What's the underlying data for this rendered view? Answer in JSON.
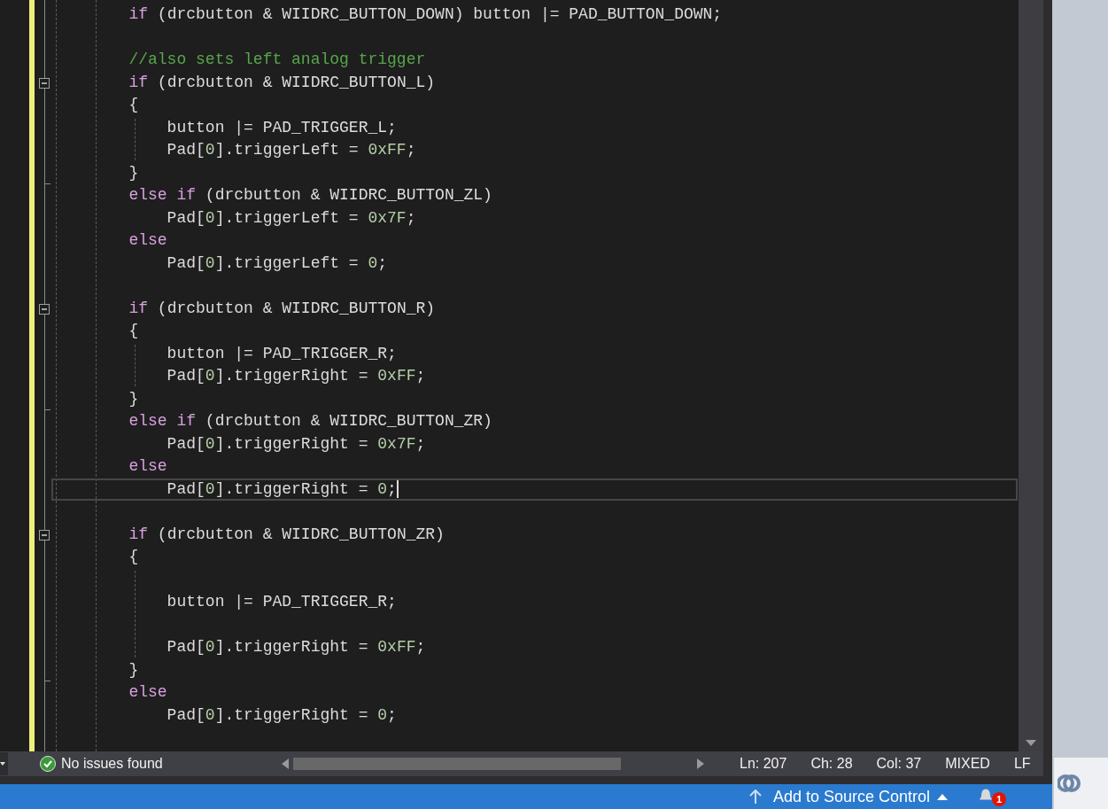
{
  "editor": {
    "lines": [
      {
        "current": false,
        "tokens": [
          {
            "kind": "keyword",
            "text": "        if"
          },
          {
            "kind": "plain",
            "text": " (drcbutton & WIIDRC_BUTTON_DOWN) button |= PAD_BUTTON_DOWN;"
          }
        ]
      },
      {
        "current": false
      },
      {
        "current": false,
        "tokens": [
          {
            "kind": "comment",
            "text": "        //also sets left analog trigger"
          }
        ]
      },
      {
        "current": false,
        "fold_start": true,
        "tokens": [
          {
            "kind": "keyword",
            "text": "        if"
          },
          {
            "kind": "plain",
            "text": " (drcbutton & WIIDRC_BUTTON_L)"
          }
        ]
      },
      {
        "current": false,
        "tokens": [
          {
            "kind": "plain",
            "text": "        {"
          }
        ]
      },
      {
        "current": false,
        "tokens": [
          {
            "kind": "plain",
            "text": "            button |= PAD_TRIGGER_L;"
          }
        ]
      },
      {
        "current": false,
        "tokens": [
          {
            "kind": "plain",
            "text": "            Pad["
          },
          {
            "kind": "number",
            "text": "0"
          },
          {
            "kind": "plain",
            "text": "].triggerLeft = "
          },
          {
            "kind": "number",
            "text": "0xFF"
          },
          {
            "kind": "plain",
            "text": ";"
          }
        ]
      },
      {
        "current": false,
        "fold_end": true,
        "tokens": [
          {
            "kind": "plain",
            "text": "        }"
          }
        ]
      },
      {
        "current": false,
        "tokens": [
          {
            "kind": "keyword",
            "text": "        else if"
          },
          {
            "kind": "plain",
            "text": " (drcbutton & WIIDRC_BUTTON_ZL)"
          }
        ]
      },
      {
        "current": false,
        "tokens": [
          {
            "kind": "plain",
            "text": "            Pad["
          },
          {
            "kind": "number",
            "text": "0"
          },
          {
            "kind": "plain",
            "text": "].triggerLeft = "
          },
          {
            "kind": "number",
            "text": "0x7F"
          },
          {
            "kind": "plain",
            "text": ";"
          }
        ]
      },
      {
        "current": false,
        "tokens": [
          {
            "kind": "keyword",
            "text": "        else"
          }
        ]
      },
      {
        "current": false,
        "tokens": [
          {
            "kind": "plain",
            "text": "            Pad["
          },
          {
            "kind": "number",
            "text": "0"
          },
          {
            "kind": "plain",
            "text": "].triggerLeft = "
          },
          {
            "kind": "number",
            "text": "0"
          },
          {
            "kind": "plain",
            "text": ";"
          }
        ]
      },
      {
        "current": false
      },
      {
        "current": false,
        "fold_start": true,
        "tokens": [
          {
            "kind": "keyword",
            "text": "        if"
          },
          {
            "kind": "plain",
            "text": " (drcbutton & WIIDRC_BUTTON_R)"
          }
        ]
      },
      {
        "current": false,
        "tokens": [
          {
            "kind": "plain",
            "text": "        {"
          }
        ]
      },
      {
        "current": false,
        "tokens": [
          {
            "kind": "plain",
            "text": "            button |= PAD_TRIGGER_R;"
          }
        ]
      },
      {
        "current": false,
        "tokens": [
          {
            "kind": "plain",
            "text": "            Pad["
          },
          {
            "kind": "number",
            "text": "0"
          },
          {
            "kind": "plain",
            "text": "].triggerRight = "
          },
          {
            "kind": "number",
            "text": "0xFF"
          },
          {
            "kind": "plain",
            "text": ";"
          }
        ]
      },
      {
        "current": false,
        "fold_end": true,
        "tokens": [
          {
            "kind": "plain",
            "text": "        }"
          }
        ]
      },
      {
        "current": false,
        "tokens": [
          {
            "kind": "keyword",
            "text": "        else if"
          },
          {
            "kind": "plain",
            "text": " (drcbutton & WIIDRC_BUTTON_ZR)"
          }
        ]
      },
      {
        "current": false,
        "tokens": [
          {
            "kind": "plain",
            "text": "            Pad["
          },
          {
            "kind": "number",
            "text": "0"
          },
          {
            "kind": "plain",
            "text": "].triggerRight = "
          },
          {
            "kind": "number",
            "text": "0x7F"
          },
          {
            "kind": "plain",
            "text": ";"
          }
        ]
      },
      {
        "current": false,
        "tokens": [
          {
            "kind": "keyword",
            "text": "        else"
          }
        ]
      },
      {
        "current": true,
        "tokens": [
          {
            "kind": "plain",
            "text": "            Pad["
          },
          {
            "kind": "number",
            "text": "0"
          },
          {
            "kind": "plain",
            "text": "].triggerRight = "
          },
          {
            "kind": "number",
            "text": "0"
          },
          {
            "kind": "plain",
            "text": ";"
          }
        ]
      },
      {
        "current": false
      },
      {
        "current": false,
        "fold_start": true,
        "tokens": [
          {
            "kind": "keyword",
            "text": "        if"
          },
          {
            "kind": "plain",
            "text": " (drcbutton & WIIDRC_BUTTON_ZR)"
          }
        ]
      },
      {
        "current": false,
        "tokens": [
          {
            "kind": "plain",
            "text": "        {"
          }
        ]
      },
      {
        "current": false
      },
      {
        "current": false,
        "tokens": [
          {
            "kind": "plain",
            "text": "            button |= PAD_TRIGGER_R;"
          }
        ]
      },
      {
        "current": false
      },
      {
        "current": false,
        "tokens": [
          {
            "kind": "plain",
            "text": "            Pad["
          },
          {
            "kind": "number",
            "text": "0"
          },
          {
            "kind": "plain",
            "text": "].triggerRight = "
          },
          {
            "kind": "number",
            "text": "0xFF"
          },
          {
            "kind": "plain",
            "text": ";"
          }
        ]
      },
      {
        "current": false,
        "fold_end": true,
        "tokens": [
          {
            "kind": "plain",
            "text": "        }"
          }
        ]
      },
      {
        "current": false,
        "tokens": [
          {
            "kind": "keyword",
            "text": "        else"
          }
        ]
      },
      {
        "current": false,
        "tokens": [
          {
            "kind": "plain",
            "text": "            Pad["
          },
          {
            "kind": "number",
            "text": "0"
          },
          {
            "kind": "plain",
            "text": "].triggerRight = "
          },
          {
            "kind": "number",
            "text": "0"
          },
          {
            "kind": "plain",
            "text": ";"
          }
        ]
      }
    ]
  },
  "editor_status": {
    "issues": {
      "passed": true,
      "text": "No issues found"
    },
    "position": [
      "Ln: 207",
      "Ch: 28",
      "Col: 37",
      "MIXED",
      "LF"
    ]
  },
  "status_bar": {
    "source_control": "Add to Source Control",
    "notification_count": "1"
  }
}
